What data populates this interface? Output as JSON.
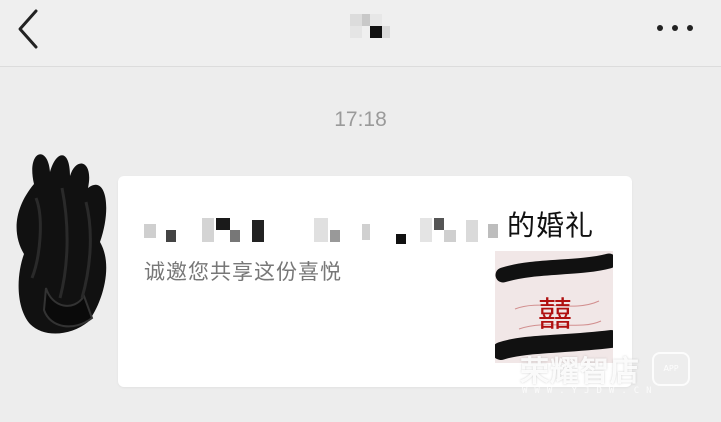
{
  "header": {
    "back_icon": "chevron-left-icon",
    "more_icon": "more-dots-icon"
  },
  "chat": {
    "timestamp": "17:18",
    "message_card": {
      "title_visible": "的婚礼",
      "description": "诚邀您共享这份喜悦",
      "thumbnail_glyph": "囍"
    }
  },
  "watermark": {
    "text": "荣耀智店",
    "url": "WWW.YJDW.CN",
    "badge": "APP"
  }
}
